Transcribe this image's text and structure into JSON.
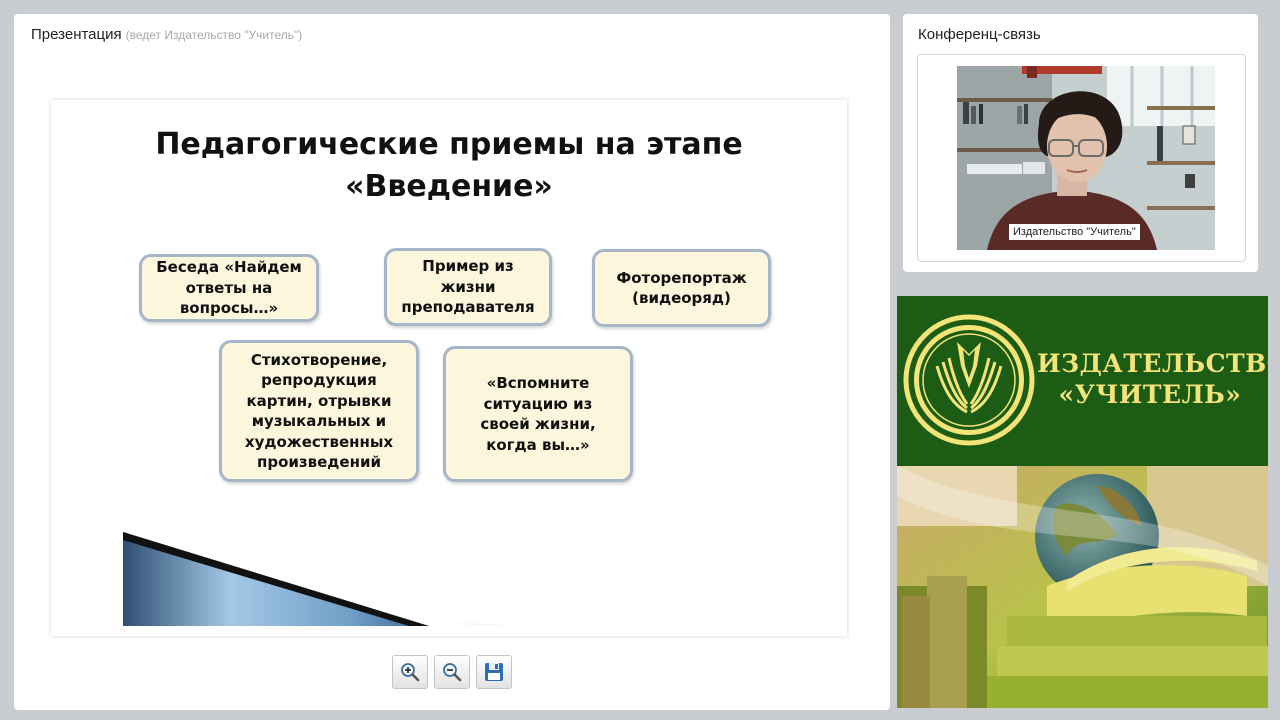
{
  "presentation": {
    "title": "Презентация",
    "subtitle": "(ведет Издательство \"Учитель\")"
  },
  "slide": {
    "title_line1": "Педагогические приемы на этапе",
    "title_line2": "«Введение»",
    "boxes": [
      {
        "lines": [
          "Беседа «Найдем",
          "ответы на",
          "вопросы…»"
        ]
      },
      {
        "lines": [
          "Пример из",
          "жизни",
          "преподавателя"
        ]
      },
      {
        "lines": [
          "Фоторепортаж",
          "(видеоряд)"
        ]
      },
      {
        "lines": [
          "Стихотворение,",
          "репродукция",
          "картин, отрывки",
          "музыкальных и",
          "художественных",
          "произведений"
        ]
      },
      {
        "lines": [
          "«Вспомните",
          "ситуацию из",
          "своей жизни,",
          "когда вы…»"
        ]
      }
    ]
  },
  "toolbar": {
    "zoom_in_icon": "magnifier-plus-icon",
    "zoom_out_icon": "magnifier-minus-icon",
    "save_icon": "floppy-disk-icon"
  },
  "conference": {
    "title": "Конференц-связь",
    "participant_name": "Издательство \"Учитель\""
  },
  "banner": {
    "brand_line1": "ИЗДАТЕЛЬСТВО",
    "brand_line2": "«УЧИТЕЛЬ»",
    "colors": {
      "green": "#1c5c14",
      "gold": "#f3e47a"
    }
  }
}
